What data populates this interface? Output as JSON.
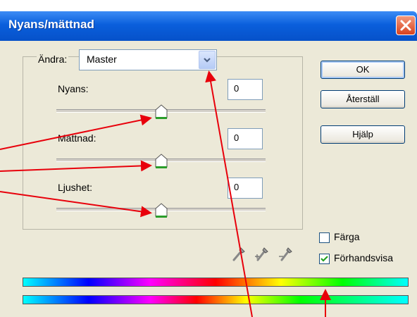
{
  "window": {
    "title": "Nyans/mättnad"
  },
  "edit": {
    "label": "Ändra:",
    "selected": "Master"
  },
  "sliders": [
    {
      "label": "Nyans:",
      "value": "0"
    },
    {
      "label": "Mättnad:",
      "value": "0"
    },
    {
      "label": "Ljushet:",
      "value": "0"
    }
  ],
  "buttons": {
    "ok": "OK",
    "reset": "Återställ",
    "help": "Hjälp"
  },
  "options": {
    "colorize": {
      "label": "Färga",
      "checked": false
    },
    "preview": {
      "label": "Förhandsvisa",
      "checked": true
    }
  },
  "colors": {
    "title_bar": "#0a5fdc",
    "annotation": "#e8000b",
    "thumb_green": "#2a9d2a"
  }
}
